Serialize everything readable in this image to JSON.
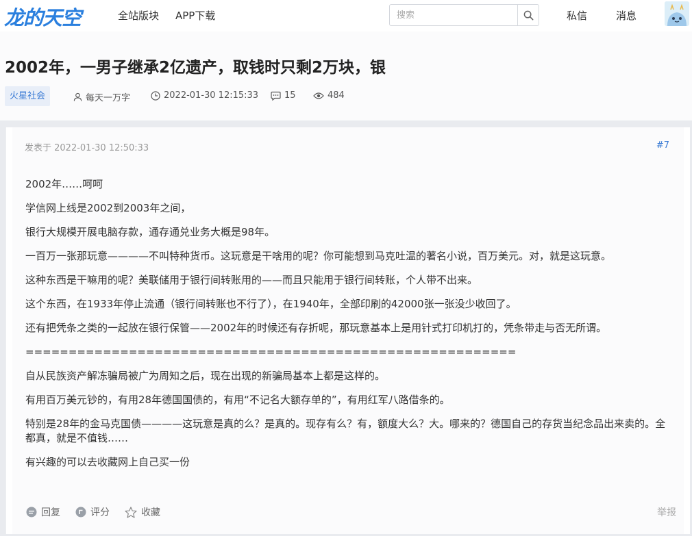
{
  "header": {
    "logo_text": "龙的天空",
    "nav": [
      "全站版块",
      "APP下载"
    ],
    "search": {
      "placeholder": "搜索",
      "value": ""
    },
    "messages_label": "私信",
    "notifications_label": "消息"
  },
  "thread": {
    "title": "2002年，一男子继承2亿遗产，取钱时只剩2万块，银",
    "tag": "火星社会",
    "author": "每天一万字",
    "timestamp": "2022-01-30 12:15:33",
    "reply_count": "15",
    "view_count": "484"
  },
  "post": {
    "posted_at": "发表于 2022-01-30 12:50:33",
    "floor": "#7",
    "paragraphs": [
      "2002年……呵呵",
      "学信网上线是2002到2003年之间，",
      "银行大规模开展电脑存款，通存通兑业务大概是98年。",
      "一百万一张那玩意————不叫特种货币。这玩意是干啥用的呢？你可能想到马克吐温的著名小说，百万美元。对，就是这玩意。",
      "这种东西是干嘛用的呢？美联储用于银行间转账用的——而且只能用于银行间转账，个人带不出来。",
      "这个东西，在1933年停止流通（银行间转账也不行了），在1940年，全部印刷的42000张一张没少收回了。",
      "还有把凭条之类的一起放在银行保管——2002年的时候还有存折呢，那玩意基本上是用针式打印机打的，凭条带走与否无所谓。",
      "=========================================================",
      "自从民族资产解冻骗局被广为周知之后，现在出现的新骗局基本上都是这样的。",
      "有用百万美元钞的，有用28年德国国债的，有用“不记名大额存单的”，有用红军八路借条的。",
      "特别是28年的金马克国债————这玩意是真的么？是真的。现存有么？有，额度大么？大。哪来的？德国自己的存货当纪念品出来卖的。全都真，就是不值钱……",
      "有兴趣的可以去收藏网上自己买一份"
    ],
    "actions": {
      "reply": "回复",
      "rate": "评分",
      "favorite": "收藏",
      "report": "举报"
    }
  },
  "colors": {
    "accent": "#3a7bd5",
    "logo": "#2a7fde",
    "tag_bg": "#e8eef8"
  },
  "icons": [
    "search-icon",
    "user-icon",
    "clock-icon",
    "comment-icon",
    "eye-icon",
    "reply-icon",
    "rate-icon",
    "star-icon"
  ]
}
